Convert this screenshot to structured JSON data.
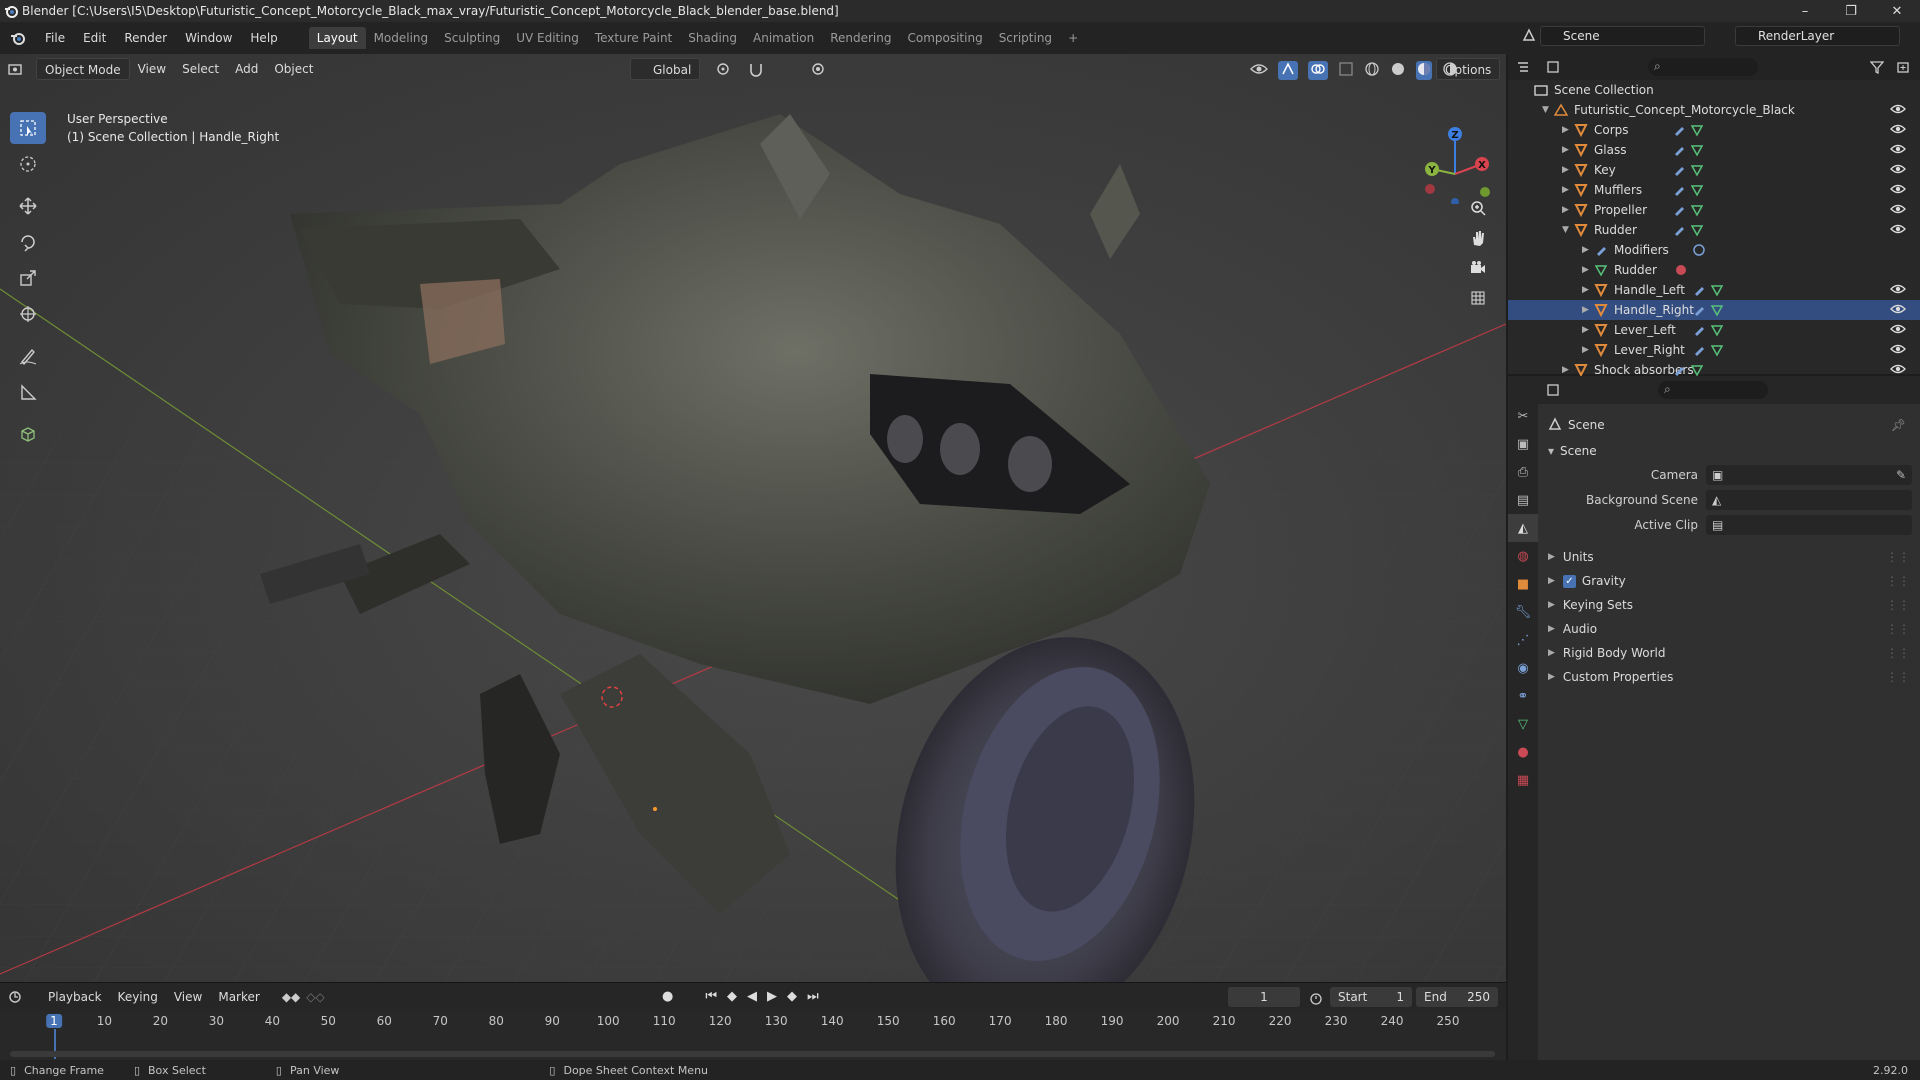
{
  "window": {
    "title": "Blender [C:\\Users\\I5\\Desktop\\Futuristic_Concept_Motorcycle_Black_max_vray/Futuristic_Concept_Motorcycle_Black_blender_base.blend]",
    "controls": [
      "–",
      "❐",
      "✕"
    ]
  },
  "menu": [
    "File",
    "Edit",
    "Render",
    "Window",
    "Help"
  ],
  "workspaces": [
    "Layout",
    "Modeling",
    "Sculpting",
    "UV Editing",
    "Texture Paint",
    "Shading",
    "Animation",
    "Rendering",
    "Compositing",
    "Scripting"
  ],
  "workspace_add": "+",
  "scene_name": "Scene",
  "view_layer": "RenderLayer",
  "viewport": {
    "mode": "Object Mode",
    "menus": [
      "View",
      "Select",
      "Add",
      "Object"
    ],
    "orientation": "Global",
    "options_label": "Options",
    "info_line1": "User Perspective",
    "info_line2": "(1) Scene Collection | Handle_Right",
    "gizmo": {
      "x": "X",
      "y": "Y",
      "z": "Z"
    }
  },
  "timeline": {
    "menus": [
      "Playback",
      "Keying",
      "View",
      "Marker"
    ],
    "current_frame": "1",
    "start_label": "Start",
    "start_value": "1",
    "end_label": "End",
    "end_value": "250",
    "ticks": [
      "1",
      "10",
      "20",
      "30",
      "40",
      "50",
      "60",
      "70",
      "80",
      "90",
      "100",
      "110",
      "120",
      "130",
      "140",
      "150",
      "160",
      "170",
      "180",
      "190",
      "200",
      "210",
      "220",
      "230",
      "240",
      "250"
    ]
  },
  "status": {
    "item1": "Change Frame",
    "item2": "Box Select",
    "item3": "Pan View",
    "item4": "Dope Sheet Context Menu",
    "version": "2.92.0"
  },
  "outliner": {
    "root": "Scene Collection",
    "collection": "Futuristic_Concept_Motorcycle_Black",
    "items": [
      {
        "label": "Corps"
      },
      {
        "label": "Glass"
      },
      {
        "label": "Key"
      },
      {
        "label": "Mufflers"
      },
      {
        "label": "Propeller"
      },
      {
        "label": "Rudder"
      },
      {
        "label": "Modifiers"
      },
      {
        "label": "Rudder"
      },
      {
        "label": "Handle_Left"
      },
      {
        "label": "Handle_Right"
      },
      {
        "label": "Lever_Left"
      },
      {
        "label": "Lever_Right"
      },
      {
        "label": "Shock absorbers"
      }
    ]
  },
  "properties": {
    "header": "Scene",
    "panel_title": "Scene",
    "camera_label": "Camera",
    "background_scene_label": "Background Scene",
    "active_clip_label": "Active Clip",
    "sections": [
      "Units",
      "Gravity",
      "Keying Sets",
      "Audio",
      "Rigid Body World",
      "Custom Properties"
    ],
    "gravity_checked": true
  },
  "colors": {
    "accent": "#4772b3",
    "x_axis": "#d9444f",
    "y_axis": "#8ab33f",
    "z_axis": "#3c7fe0",
    "object_icon": "#e08a3c"
  }
}
